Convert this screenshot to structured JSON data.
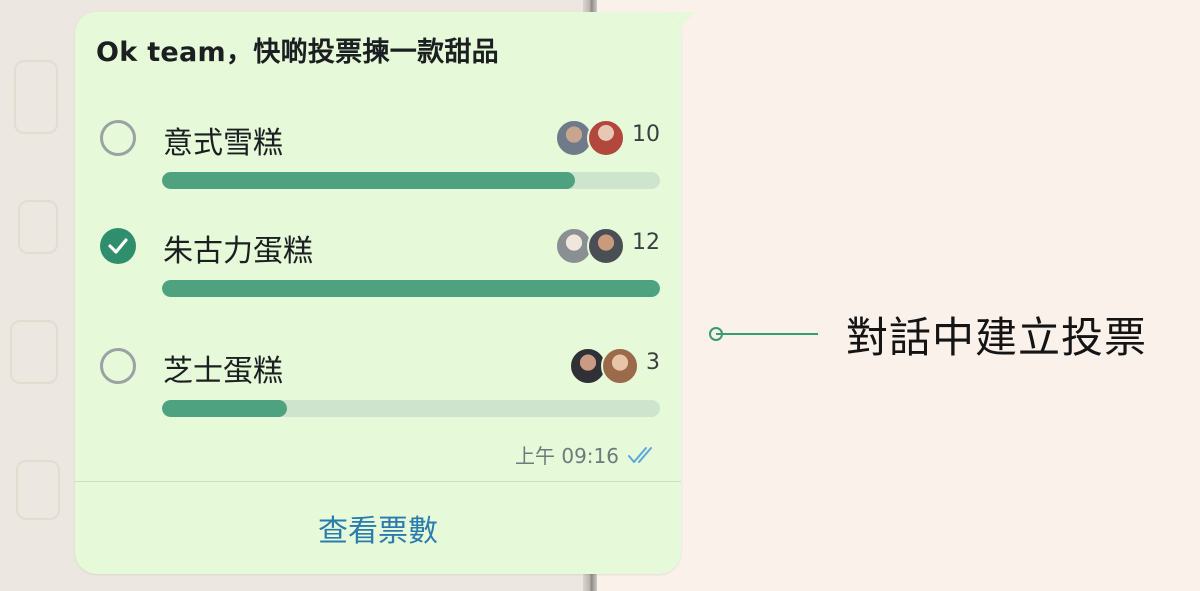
{
  "poll": {
    "question": "Ok team，快啲投票揀一款甜品",
    "options": [
      {
        "label": "意式雪糕",
        "votes": "10",
        "fill_fraction": 0.83,
        "selected": false
      },
      {
        "label": "朱古力蛋糕",
        "votes": "12",
        "fill_fraction": 1.0,
        "selected": true
      },
      {
        "label": "芝士蛋糕",
        "votes": "3",
        "fill_fraction": 0.25,
        "selected": false
      }
    ],
    "time": "上午 09:16",
    "view_votes_label": "查看票數"
  },
  "callout": {
    "text": "對話中建立投票"
  },
  "colors": {
    "bubble": "#e6f9d8",
    "accent_green": "#4fa27f",
    "check_green": "#2f8f6d",
    "link_blue": "#2a7cae",
    "read_tick_blue": "#5aa7de"
  }
}
